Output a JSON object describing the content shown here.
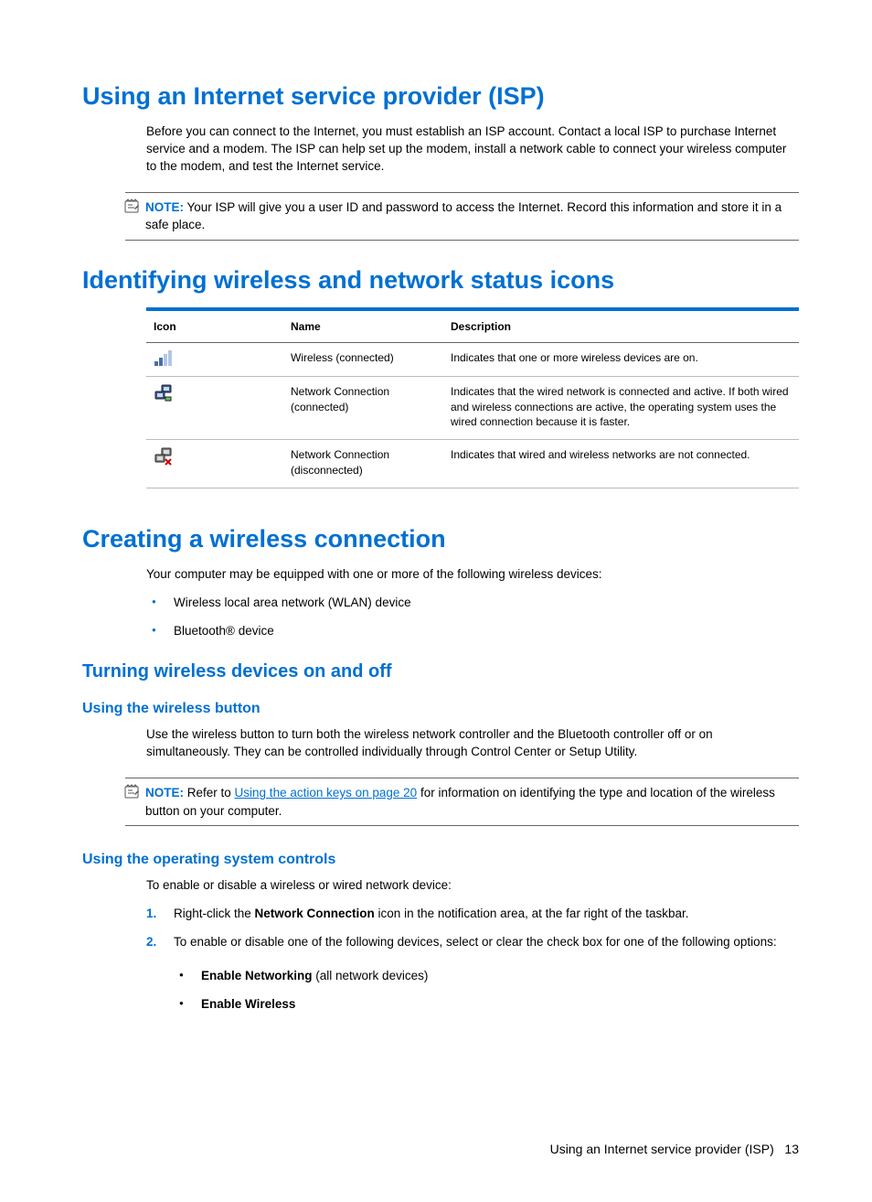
{
  "section1": {
    "title": "Using an Internet service provider (ISP)",
    "para": "Before you can connect to the Internet, you must establish an ISP account. Contact a local ISP to purchase Internet service and a modem. The ISP can help set up the modem, install a network cable to connect your wireless computer to the modem, and test the Internet service.",
    "note_label": "NOTE:",
    "note_text": "Your ISP will give you a user ID and password to access the Internet. Record this information and store it in a safe place."
  },
  "section2": {
    "title": "Identifying wireless and network status icons",
    "headers": {
      "icon": "Icon",
      "name": "Name",
      "desc": "Description"
    },
    "rows": [
      {
        "name": "Wireless (connected)",
        "desc": "Indicates that one or more wireless devices are on."
      },
      {
        "name": "Network Connection (connected)",
        "desc": "Indicates that the wired network is connected and active. If both wired and wireless connections are active, the operating system uses the wired connection because it is faster."
      },
      {
        "name": "Network Connection (disconnected)",
        "desc": "Indicates that wired and wireless networks are not connected."
      }
    ]
  },
  "section3": {
    "title": "Creating a wireless connection",
    "intro": "Your computer may be equipped with one or more of the following wireless devices:",
    "devices": [
      "Wireless local area network (WLAN) device",
      "Bluetooth® device"
    ],
    "subA": {
      "title": "Turning wireless devices on and off",
      "wb": {
        "title": "Using the wireless button",
        "para": "Use the wireless button to turn both the wireless network controller and the Bluetooth controller off or on simultaneously. They can be controlled individually through Control Center or Setup Utility.",
        "note_label": "NOTE:",
        "note_pre": "Refer to ",
        "note_link": "Using the action keys on page 20",
        "note_post": " for information on identifying the type and location of the wireless button on your computer."
      },
      "os": {
        "title": "Using the operating system controls",
        "para": "To enable or disable a wireless or wired network device:",
        "steps": [
          {
            "num": "1.",
            "pre": "Right-click the ",
            "bold": "Network Connection",
            "post": " icon in the notification area, at the far right of the taskbar."
          },
          {
            "num": "2.",
            "text": "To enable or disable one of the following devices, select or clear the check box for one of the following options:"
          }
        ],
        "opts": [
          {
            "bold": "Enable Networking",
            "post": " (all network devices)"
          },
          {
            "bold": "Enable Wireless",
            "post": ""
          }
        ]
      }
    }
  },
  "footer": {
    "text": "Using an Internet service provider (ISP)",
    "page": "13"
  }
}
